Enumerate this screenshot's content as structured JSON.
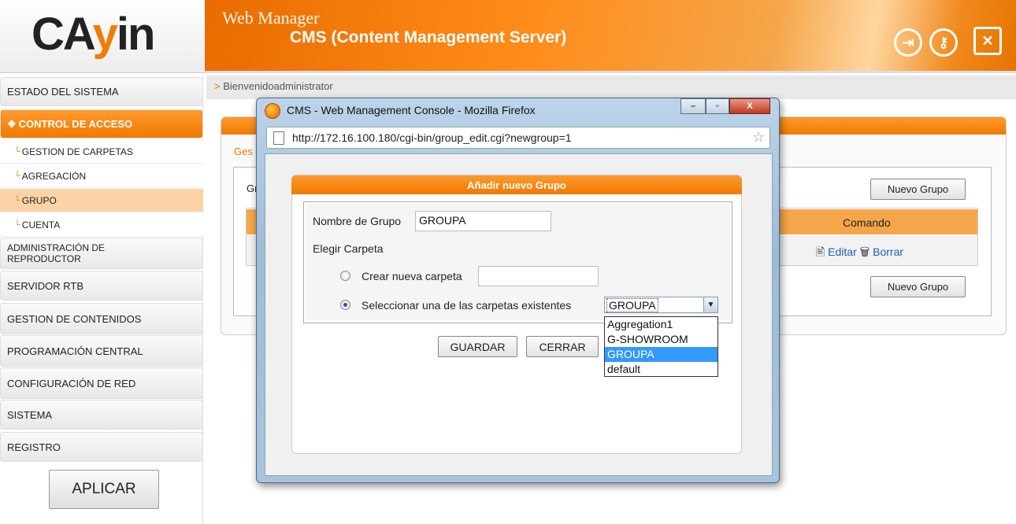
{
  "header": {
    "logo": "CAYIN",
    "title_line1": "Web Manager",
    "title_line2": "CMS (Content Management Server)",
    "icons": [
      "logout-icon",
      "key-icon",
      "tools-icon"
    ]
  },
  "sidebar": {
    "items": [
      {
        "label": "ESTADO DEL SISTEMA"
      },
      {
        "label": "CONTROL DE ACCESO"
      },
      {
        "label": "GESTION DE CARPETAS"
      },
      {
        "label": "AGREGACIÓN"
      },
      {
        "label": "GRUPO"
      },
      {
        "label": "CUENTA"
      },
      {
        "label": "ADMINISTRACIÓN DE REPRODUCTOR"
      },
      {
        "label": "SERVIDOR RTB"
      },
      {
        "label": "GESTION DE CONTENIDOS"
      },
      {
        "label": "PROGRAMACIÓN CENTRAL"
      },
      {
        "label": "CONFIGURACIÓN DE RED"
      },
      {
        "label": "SISTEMA"
      },
      {
        "label": "REGISTRO"
      }
    ],
    "apply_label": "APLICAR"
  },
  "main": {
    "welcome": "Bienvenidoadministrator",
    "crumb": "Ges",
    "group_label": "Gr",
    "new_group_label": "Nuevo Grupo",
    "col_command": "Comando",
    "edit_label": "Editar",
    "delete_label": "Borrar"
  },
  "firefox": {
    "title": "CMS - Web Management Console - Mozilla Firefox",
    "url": "http://172.16.100.180/cgi-bin/group_edit.cgi?newgroup=1"
  },
  "dialog": {
    "title": "Añadir nuevo Grupo",
    "group_name_label": "Nombre de Grupo",
    "group_name_value": "GROUPA",
    "choose_folder_label": "Elegir Carpeta",
    "create_folder_label": "Crear nueva carpeta",
    "create_folder_value": "",
    "select_existing_label": "Seleccionar una de las carpetas existentes",
    "selected_folder": "GROUPA",
    "folder_options": [
      "Aggregation1",
      "G-SHOWROOM",
      "GROUPA",
      "default"
    ],
    "save_label": "GUARDAR",
    "close_label": "CERRAR"
  }
}
